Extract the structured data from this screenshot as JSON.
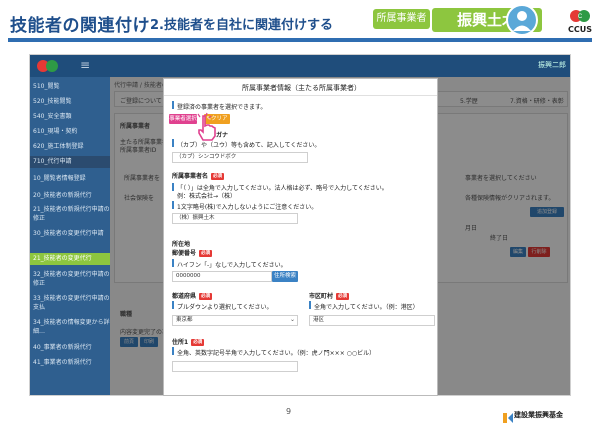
{
  "banner": {
    "title": "技能者の関連付け",
    "subtitle": "2.技能者を自社に関連付けする",
    "tag": "所属事業者",
    "company": "振興土木",
    "ccus_label": "CCUS"
  },
  "app": {
    "user": "振興二郎",
    "breadcrumb": "代行申請 / 技能者の",
    "sidebar": [
      "510_閲覧",
      "520_技能閲覧",
      "540_安全書類",
      "610_現場・契約",
      "620_施工体制登録",
      "710_代行申請",
      "10_閲覧者情報登録",
      "20_技能者の新規代行",
      "21_技能者の新規代行申請の修正",
      "30_技能者の変更代行申請",
      "21_技能者の変更代行",
      "32_技能者の変更代行申請の修正",
      "33_技能者の変更代行申請の支払",
      "34_技能者の情報変更から詳細…",
      "40_事業者の新規代行",
      "41_事業者の新規代行"
    ],
    "background": {
      "notice": "ご登録について",
      "section1": "所属事業者",
      "section2a": "主たる所属事業者",
      "section2b": "所属事業者ID",
      "row1": "所属事業者を",
      "row2": "社会保険を",
      "right1": "事業者を選択してください",
      "right2": "各種保険情報がクリアされます。",
      "right_head": "終了日",
      "right_head2": "月日",
      "btn_edit": "編集",
      "btn_delete": "行削除",
      "btn_add": "追加登録",
      "tab1": "5.学歴",
      "tab2": "7.資格・研修・表彰",
      "job": "職種",
      "bottom1": "内容変更完了の場合は",
      "bottom2": "前頁",
      "bottom3": "印刷"
    }
  },
  "modal": {
    "title": "所属事業者情報（主たる所属事業者）",
    "select_note": "登録済の事業者を選択できます。",
    "select_button": "事業者選択",
    "clear_button": "クリア",
    "furigana_label": "フリガナ",
    "furigana_note": "（カブ）や（ユウ）等も含めて、記入してください。",
    "furigana_value": "（カブ）シンコウドボク",
    "name_label": "所属事業者名",
    "required": "必須",
    "name_note1": "「（ ）」は全角で入力してください。法人格は必ず、略号で入力してください。",
    "name_note2": "例：株式会社→（株）",
    "name_note3": "1文字略号(株)で入力しないようにご注意ください。",
    "name_value": "（株）振興土木",
    "address_heading": "所在地",
    "postal_label": "郵便番号",
    "postal_note": "ハイフン「-」なしで入力してください。",
    "postal_value": "0000000",
    "postal_search": "住所検索",
    "pref_label": "都道府県",
    "pref_note": "プルダウンより選択してください。",
    "pref_value": "東京都",
    "city_label": "市区町村",
    "city_note": "全角で入力してください。（例：港区）",
    "city_value": "港区",
    "addr1_label": "住所1",
    "addr1_note": "全角、英数字記号半角で入力してください。（例：虎ノ門××× ○○ビル）"
  },
  "footer": {
    "page": "9",
    "fund": "建設業振興基金"
  },
  "colors": {
    "brand_blue": "#1f4f8c",
    "green": "#8dc63f",
    "pink": "#e0418f",
    "orange": "#f0a020",
    "required_red": "#e53935"
  }
}
